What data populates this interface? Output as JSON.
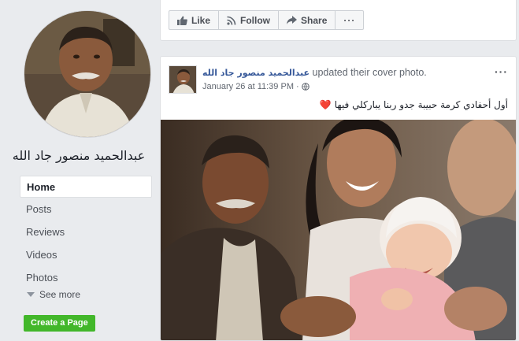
{
  "profile": {
    "name": "عبدالحميد منصور جاد الله"
  },
  "nav": {
    "items": [
      {
        "label": "Home",
        "active": true
      },
      {
        "label": "Posts"
      },
      {
        "label": "Reviews"
      },
      {
        "label": "Videos"
      },
      {
        "label": "Photos"
      }
    ],
    "see_more": "See more",
    "create_page": "Create a Page"
  },
  "actions": {
    "like": "Like",
    "follow": "Follow",
    "share": "Share",
    "more": "···"
  },
  "post": {
    "author": "عبدالحميد منصور جاد الله",
    "action_text": "updated their cover photo.",
    "timestamp": "January 26 at 11:39 PM",
    "separator": "·",
    "menu": "···",
    "text": "أول أحفادي كرمة حبيبة جدو ربنا يباركلي فيها",
    "emoji": "❤️"
  },
  "colors": {
    "link": "#365899",
    "create_page_bg": "#42b72a",
    "page_bg": "#e9ebee"
  }
}
